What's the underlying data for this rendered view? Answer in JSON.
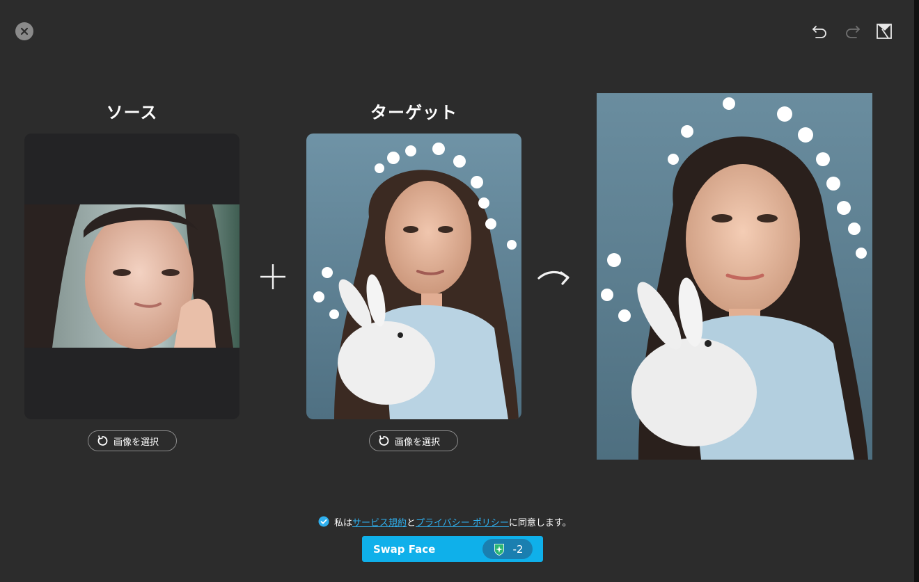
{
  "source": {
    "title": "ソース",
    "select_label": "画像を選択"
  },
  "target": {
    "title": "ターゲット",
    "select_label": "画像を選択"
  },
  "consent": {
    "prefix": "私は",
    "terms_link": "サービス規約",
    "middle": "と",
    "privacy_link": "プライバシー ポリシー",
    "suffix": "に同意します。",
    "checked": true
  },
  "swap_button": {
    "label": "Swap Face",
    "credit": "-2"
  },
  "colors": {
    "accent": "#0fb0ea",
    "link": "#2fb0ef",
    "background": "#2c2c2c"
  },
  "icons": [
    "close-icon",
    "undo-icon",
    "redo-icon",
    "eraser-icon",
    "refresh-icon",
    "plus-icon",
    "curved-arrow-icon",
    "check-circle-icon",
    "sparkle-shield-icon"
  ]
}
